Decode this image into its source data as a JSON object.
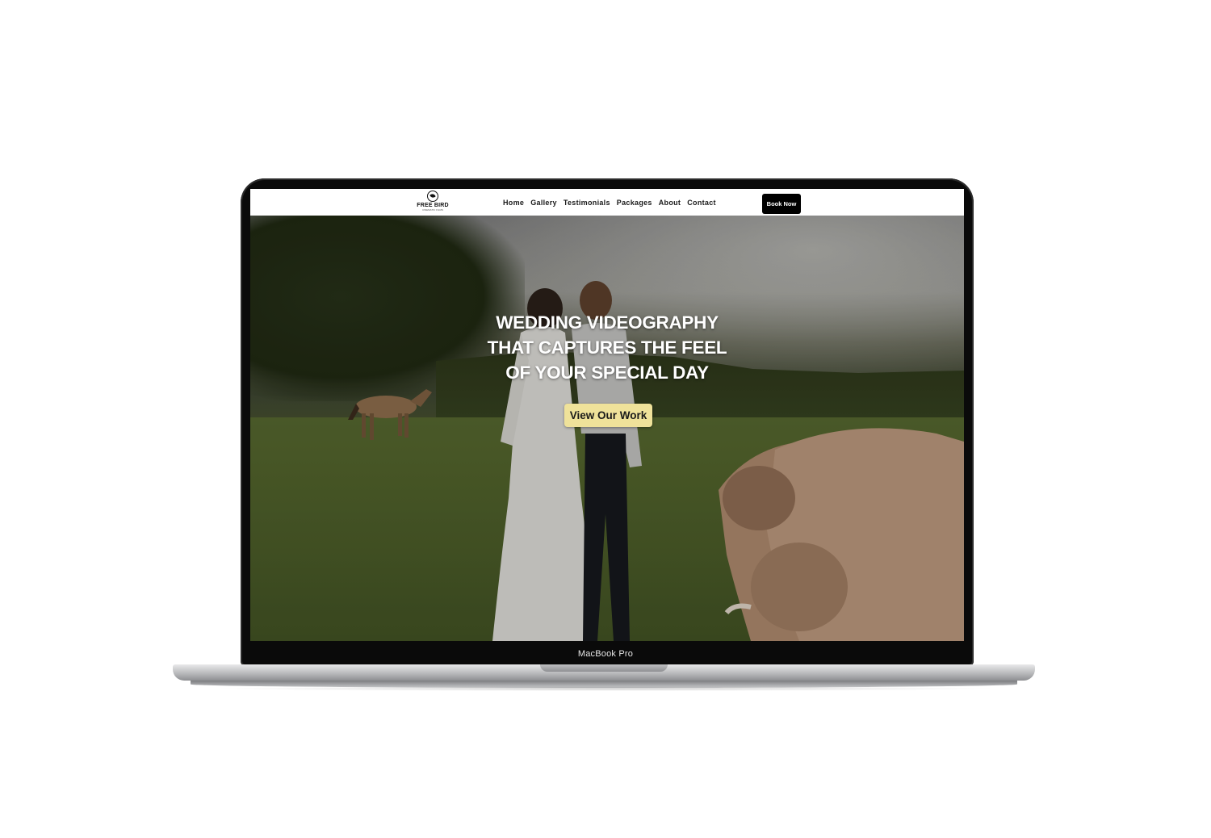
{
  "device": {
    "label": "MacBook Pro"
  },
  "site": {
    "logo": {
      "name": "FREE BIRD",
      "tagline": "CINEMATIC FILMS"
    },
    "nav": {
      "items": [
        {
          "label": "Home"
        },
        {
          "label": "Gallery"
        },
        {
          "label": "Testimonials"
        },
        {
          "label": "Packages"
        },
        {
          "label": "About"
        },
        {
          "label": "Contact"
        }
      ],
      "cta_label": "Book Now"
    },
    "hero": {
      "headline_lines": [
        "WEDDING VIDEOGRAPHY",
        "THAT CAPTURES THE FEEL",
        "OF YOUR SPECIAL DAY"
      ],
      "cta_label": "View Our Work",
      "cta_color": "#efe29a"
    }
  },
  "colors": {
    "nav_bg": "#ffffff",
    "book_button_bg": "#000000",
    "laptop_bezel": "#0a0a0a"
  },
  "icons": [
    "bird-logo-icon"
  ]
}
